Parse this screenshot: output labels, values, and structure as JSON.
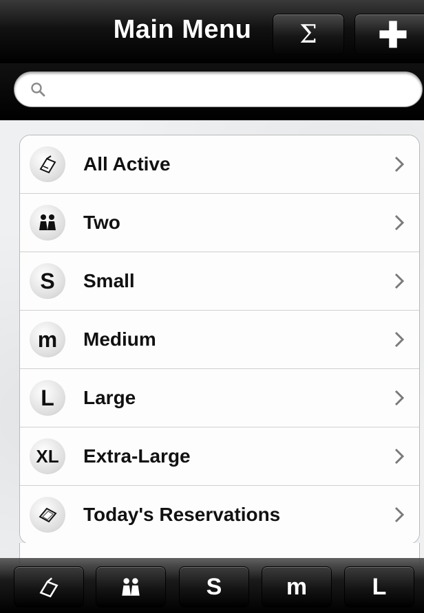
{
  "navbar": {
    "title": "Main Menu",
    "sum_symbol": "Σ"
  },
  "search": {
    "placeholder": "",
    "value": ""
  },
  "menu": [
    {
      "label": "All Active",
      "icon": "notepad-icon",
      "icon_text": ""
    },
    {
      "label": "Two",
      "icon": "two-people-icon",
      "icon_text": ""
    },
    {
      "label": "Small",
      "icon": "small-s-icon",
      "icon_text": "S"
    },
    {
      "label": "Medium",
      "icon": "medium-m-icon",
      "icon_text": "m"
    },
    {
      "label": "Large",
      "icon": "large-l-icon",
      "icon_text": "L"
    },
    {
      "label": "Extra-Large",
      "icon": "extra-large-xl-icon",
      "icon_text": "XL"
    },
    {
      "label": "Today's Reservations",
      "icon": "reservation-book-icon",
      "icon_text": ""
    }
  ],
  "tabs": [
    {
      "name": "all-active",
      "icon": "notepad-icon",
      "text": ""
    },
    {
      "name": "two",
      "icon": "two-people-icon",
      "text": ""
    },
    {
      "name": "small",
      "icon": "small-s-icon",
      "text": "S"
    },
    {
      "name": "medium",
      "icon": "medium-m-icon",
      "text": "m"
    },
    {
      "name": "large",
      "icon": "large-l-icon",
      "text": "L"
    }
  ]
}
